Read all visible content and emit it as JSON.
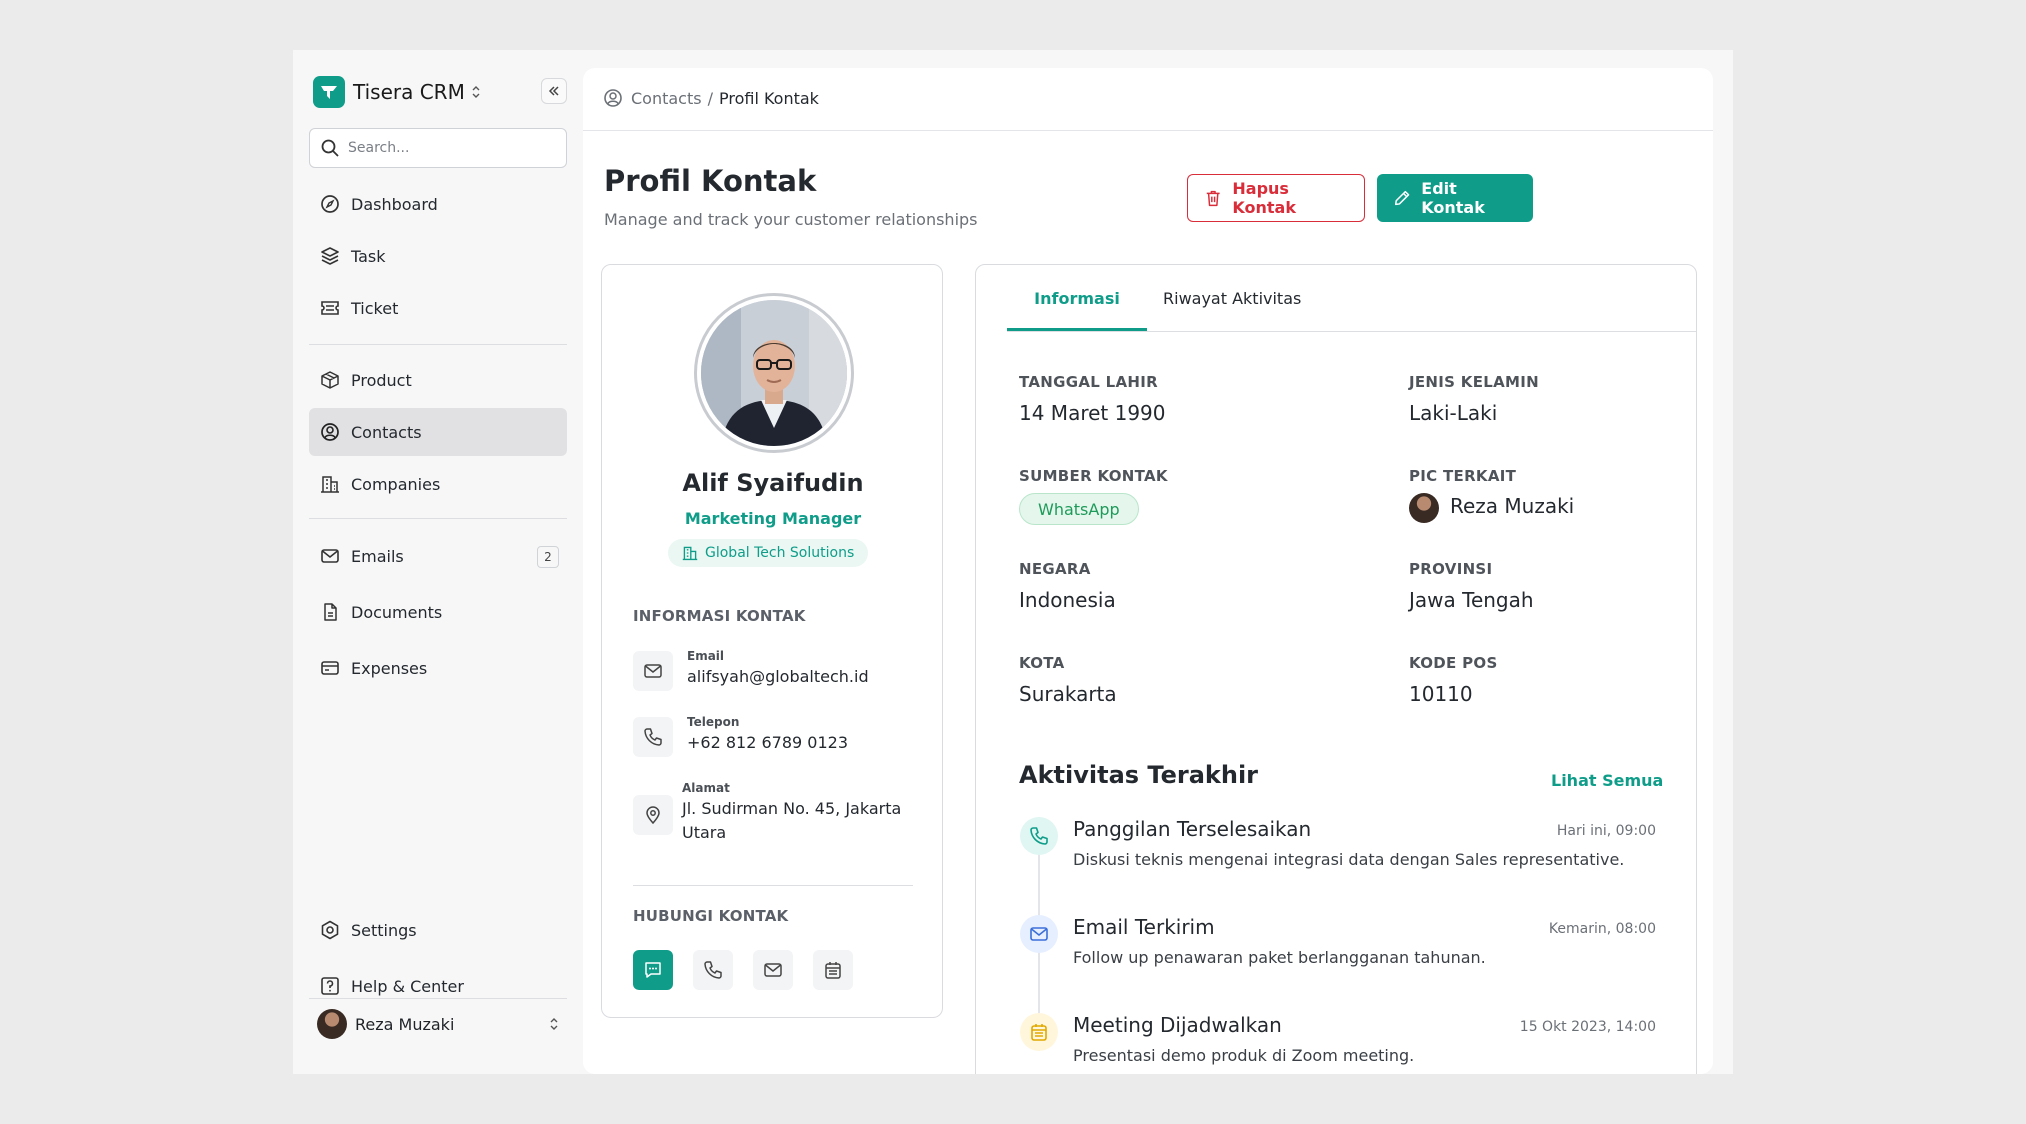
{
  "app": {
    "name": "Tisera CRM",
    "search_placeholder": "Search..."
  },
  "sidebar": {
    "nav_primary": [
      {
        "label": "Dashboard",
        "icon": "dashboard-icon"
      },
      {
        "label": "Task",
        "icon": "layers-icon"
      },
      {
        "label": "Ticket",
        "icon": "ticket-icon"
      }
    ],
    "nav_secondary": [
      {
        "label": "Product",
        "icon": "box-icon"
      },
      {
        "label": "Contacts",
        "icon": "user-circle-icon",
        "active": true
      },
      {
        "label": "Companies",
        "icon": "building-icon"
      }
    ],
    "nav_tertiary": [
      {
        "label": "Emails",
        "icon": "mail-icon",
        "badge": "2"
      },
      {
        "label": "Documents",
        "icon": "document-icon"
      },
      {
        "label": "Expenses",
        "icon": "card-icon"
      }
    ],
    "settings_label": "Settings",
    "help_label": "Help & Center",
    "user_name": "Reza Muzaki"
  },
  "breadcrumb": {
    "parent": "Contacts",
    "separator": "/",
    "current": "Profil Kontak"
  },
  "header": {
    "title": "Profil Kontak",
    "subtitle": "Manage and track your customer relationships",
    "delete_label": "Hapus Kontak",
    "edit_label": "Edit Kontak"
  },
  "profile": {
    "name": "Alif Syaifudin",
    "role": "Marketing Manager",
    "company": "Global Tech Solutions",
    "contact_section": "INFORMASI KONTAK",
    "email_label": "Email",
    "email": "alifsyah@globaltech.id",
    "phone_label": "Telepon",
    "phone": "+62 812 6789 0123",
    "address_label": "Alamat",
    "address_line1": "Jl. Sudirman No. 45, Jakarta",
    "address_line2": "Utara",
    "reach_section": "HUBUNGI KONTAK"
  },
  "tabs": {
    "info": "Informasi",
    "history": "Riwayat Aktivitas"
  },
  "fields": {
    "birth_label": "TANGGAL LAHIR",
    "birth_value": "14 Maret 1990",
    "gender_label": "JENIS KELAMIN",
    "gender_value": "Laki-Laki",
    "source_label": "SUMBER KONTAK",
    "source_value": "WhatsApp",
    "pic_label": "PIC TERKAIT",
    "pic_value": "Reza Muzaki",
    "country_label": "NEGARA",
    "country_value": "Indonesia",
    "province_label": "PROVINSI",
    "province_value": "Jawa Tengah",
    "city_label": "KOTA",
    "city_value": "Surakarta",
    "zip_label": "KODE POS",
    "zip_value": "10110"
  },
  "activities": {
    "title": "Aktivitas Terakhir",
    "see_all": "Lihat Semua",
    "items": [
      {
        "name": "Panggilan Terselesaikan",
        "time": "Hari ini, 09:00",
        "desc": "Diskusi teknis mengenai integrasi data dengan Sales representative.",
        "icon": "phone-icon"
      },
      {
        "name": "Email Terkirim",
        "time": "Kemarin, 08:00",
        "desc": "Follow up penawaran paket berlangganan tahunan.",
        "icon": "mail-icon"
      },
      {
        "name": "Meeting Dijadwalkan",
        "time": "15 Okt 2023, 14:00",
        "desc": "Presentasi demo produk di Zoom meeting.",
        "icon": "calendar-icon"
      }
    ]
  },
  "colors": {
    "accent": "#0f9d8a",
    "danger": "#d92d3a",
    "whatsapp": "#1e9b5a"
  }
}
